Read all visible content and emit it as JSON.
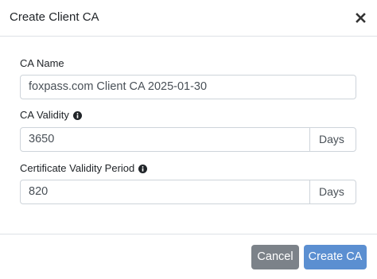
{
  "modal": {
    "title": "Create Client CA",
    "close_icon": "close-icon"
  },
  "form": {
    "ca_name": {
      "label": "CA Name",
      "value": "foxpass.com Client CA 2025-01-30"
    },
    "ca_validity": {
      "label": "CA Validity",
      "info_icon": "info-icon",
      "value": "3650",
      "unit": "Days"
    },
    "certificate_validity": {
      "label": "Certificate Validity Period",
      "info_icon": "info-icon",
      "value": "820",
      "unit": "Days"
    }
  },
  "footer": {
    "cancel_label": "Cancel",
    "create_label": "Create CA"
  },
  "colors": {
    "cancel_button": "#7c8289",
    "create_button": "#5b8fd1"
  }
}
